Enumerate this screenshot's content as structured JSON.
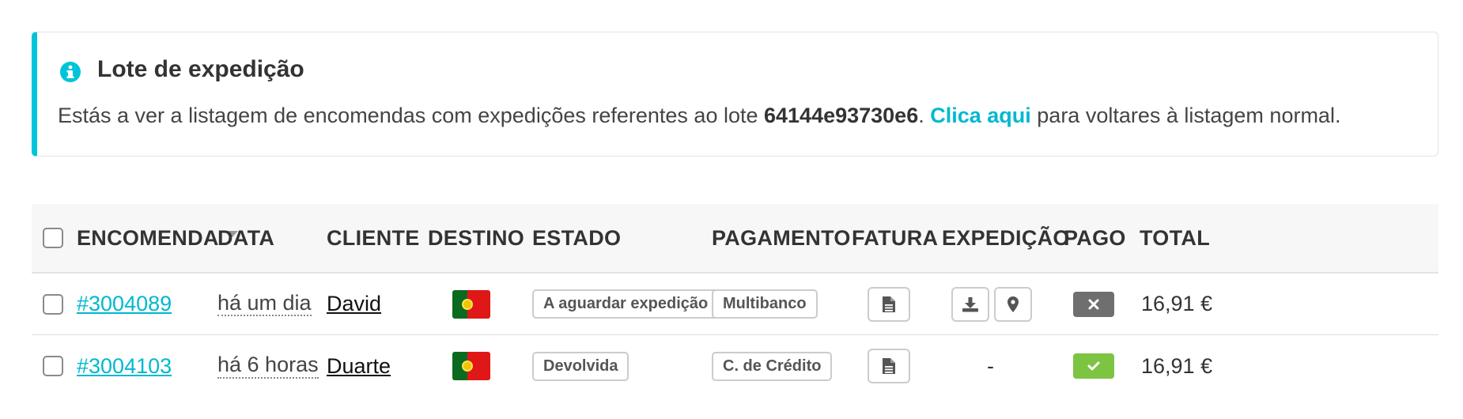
{
  "notice": {
    "title": "Lote de expedição",
    "text_before": "Estás a ver a listagem de encomendas com expedições referentes ao lote ",
    "batch_id": "64144e93730e6",
    "text_mid": ". ",
    "link_label": "Clica aqui",
    "text_after": " para voltares à listagem normal.",
    "accent_color": "#00c4d9",
    "icon": "info-icon"
  },
  "table": {
    "headers": {
      "order": "ENCOMENDA",
      "date": "DATA",
      "client": "CLIENTE",
      "destination": "DESTINO",
      "status": "ESTADO",
      "payment": "PAGAMENTO",
      "invoice": "FATURA",
      "shipping": "EXPEDIÇÃO",
      "paid": "PAGO",
      "total": "TOTAL"
    },
    "sorted_by": "order",
    "rows": [
      {
        "order": "#3004089",
        "date": "há um dia",
        "client": "David",
        "destination_flag": "portugal-flag",
        "status": "A aguardar expedição",
        "payment": "Multibanco",
        "invoice_icon": "document-icon",
        "shipping": "",
        "shipping_icons": [
          "download-icon",
          "map-pin-icon"
        ],
        "paid": false,
        "total": "16,91 €"
      },
      {
        "order": "#3004103",
        "date": "há 6 horas",
        "client": "Duarte",
        "destination_flag": "portugal-flag",
        "status": "Devolvida",
        "payment": "C. de Crédito",
        "invoice_icon": "document-icon",
        "shipping": "-",
        "shipping_icons": [],
        "paid": true,
        "total": "16,91 €"
      }
    ]
  },
  "colors": {
    "link": "#00b8d0",
    "paid_yes": "#7dc443",
    "paid_no": "#6f6f6f"
  }
}
